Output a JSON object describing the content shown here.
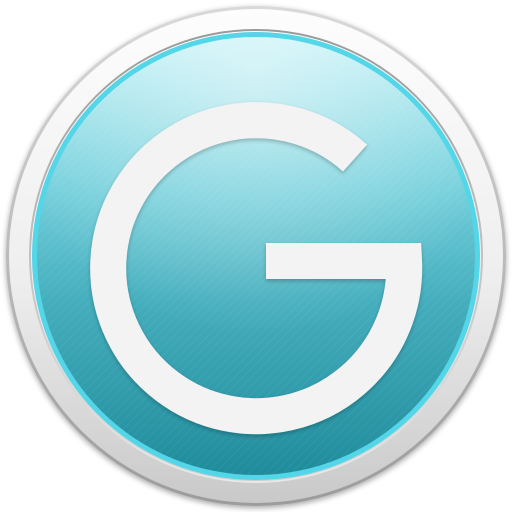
{
  "app_icon": {
    "icon": "g-letter-logo-icon",
    "glyph": "G",
    "colors": {
      "background": "#ffffff",
      "bezel_light": "#fbfbfb",
      "bezel_mid": "#e6e6e6",
      "bezel_dark": "#a9a9a9",
      "face_top": "#c2f1f6",
      "face_mid": "#52bccb",
      "face_bottom": "#1f8c9c",
      "face_rim": "#53d6e8",
      "letter": "#f3f3f3"
    }
  }
}
